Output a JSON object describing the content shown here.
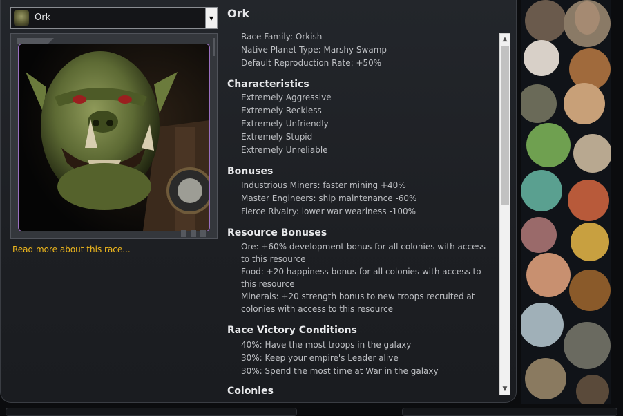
{
  "race_selector": {
    "selected": "Ork"
  },
  "read_more_link": "Read more about this race...",
  "race_title": "Ork",
  "general_info": [
    "Race Family: Orkish",
    "Native Planet Type: Marshy Swamp",
    "Default Reproduction Rate: +50%"
  ],
  "characteristics": {
    "heading": "Characteristics",
    "items": [
      "Extremely Aggressive",
      "Extremely Reckless",
      "Extremely Unfriendly",
      "Extremely Stupid",
      "Extremely Unreliable"
    ]
  },
  "bonuses": {
    "heading": "Bonuses",
    "items": [
      "Industrious Miners: faster mining +40%",
      "Master Engineers: ship maintenance -60%",
      "Fierce Rivalry: lower war weariness -100%"
    ]
  },
  "resource_bonuses": {
    "heading": "Resource Bonuses",
    "items": [
      "Ore: +60% development bonus for all colonies with access to this resource",
      "Food: +20 happiness bonus for all colonies with access to this resource",
      "Minerals: +20 strength bonus to new troops recruited at colonies with access to this resource"
    ]
  },
  "victory_conditions": {
    "heading": "Race Victory Conditions",
    "items": [
      "40%:  Have the most troops in the galaxy",
      "30%:  Keep your empire's Leader alive",
      "30%:  Spend the most time at War in the galaxy"
    ]
  },
  "colonies": {
    "heading": "Colonies"
  },
  "colors": {
    "link": "#f1b91d",
    "panel": "#1f2125",
    "text": "#bdbfc3",
    "heading": "#e8e9eb",
    "portrait_border": "#9a6fc1"
  },
  "icons": {
    "dropdown_arrow": "chevron-down-icon",
    "scroll_up": "arrow-up-icon",
    "scroll_down": "arrow-down-icon"
  }
}
